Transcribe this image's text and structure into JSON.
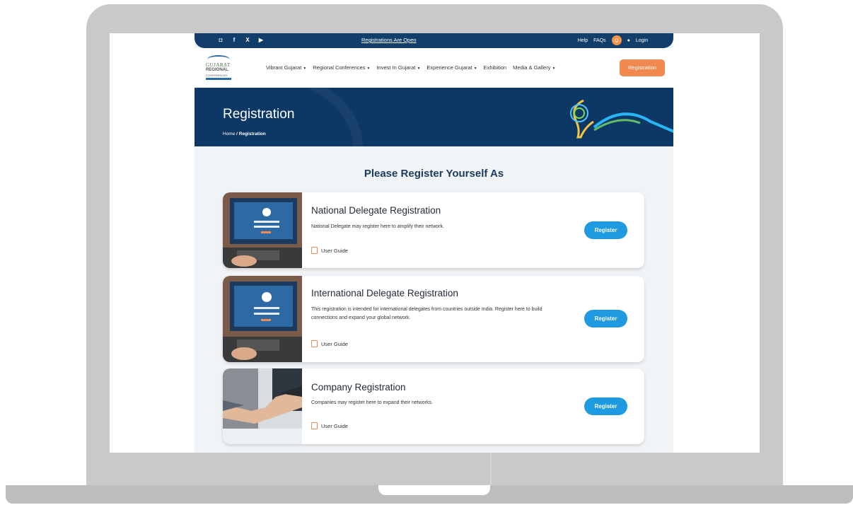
{
  "topbar": {
    "announcement": "Registrations Are Open",
    "help": "Help",
    "faqs": "FAQs",
    "login": "Login"
  },
  "logo": {
    "line1": "GUJARAT",
    "line2": "REGIONAL",
    "line3": "CONFERENCES"
  },
  "nav": {
    "items": [
      {
        "label": "Vibrant Gujarat",
        "dropdown": true
      },
      {
        "label": "Regional Conferences",
        "dropdown": true
      },
      {
        "label": "Invest In Gujarat",
        "dropdown": true
      },
      {
        "label": "Experience Gujarat",
        "dropdown": true
      },
      {
        "label": "Exhibition",
        "dropdown": false
      },
      {
        "label": "Media & Gallery",
        "dropdown": true
      }
    ],
    "registration_button": "Registration"
  },
  "hero": {
    "title": "Registration",
    "breadcrumb_home": "Home",
    "breadcrumb_current": "/ Registration"
  },
  "main": {
    "heading": "Please Register Yourself As",
    "cards": [
      {
        "title": "National Delegate Registration",
        "description": "National Delegate may register here to amplify their network.",
        "guide": "User Guide",
        "button": "Register"
      },
      {
        "title": "International Delegate Registration",
        "description": "This registration is intended for international delegates from countries outside India. Register here to build connections and expand your global network.",
        "guide": "User Guide",
        "button": "Register"
      },
      {
        "title": "Company Registration",
        "description": "Companies may register here to expand their networks.",
        "guide": "User Guide",
        "button": "Register"
      }
    ]
  },
  "colors": {
    "navy": "#123e6c",
    "accent_orange": "#f0884f",
    "button_blue": "#1e9be0"
  }
}
